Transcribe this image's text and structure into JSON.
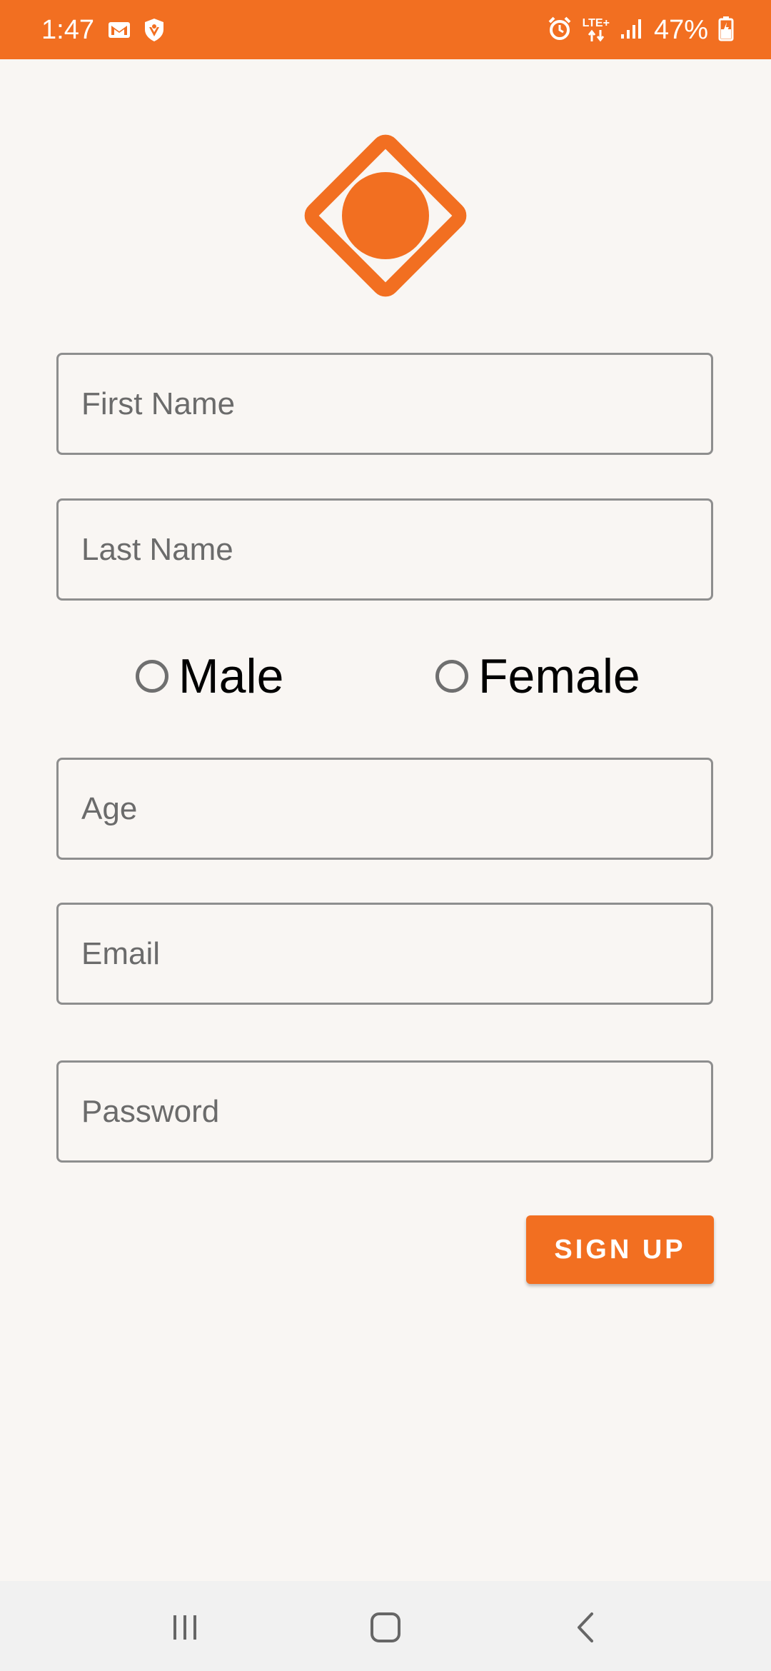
{
  "status_bar": {
    "time": "1:47",
    "battery": "47%",
    "network": "LTE+",
    "background_color": "#f26f21",
    "icons": [
      "gmail-icon",
      "shield-icon",
      "alarm-icon",
      "lte-icon",
      "signal-icon",
      "battery-icon"
    ]
  },
  "app": {
    "logo_icon": "diamond-circle-logo",
    "accent_color": "#f26f21"
  },
  "form": {
    "first_name": {
      "placeholder": "First Name",
      "value": ""
    },
    "last_name": {
      "placeholder": "Last Name",
      "value": ""
    },
    "gender": {
      "options": [
        "Male",
        "Female"
      ],
      "selected": null
    },
    "age": {
      "placeholder": "Age",
      "value": ""
    },
    "email": {
      "placeholder": "Email",
      "value": ""
    },
    "password": {
      "placeholder": "Password",
      "value": ""
    },
    "submit_label": "SIGN UP"
  },
  "nav_bar": {
    "icons": [
      "recent-apps-icon",
      "home-icon",
      "back-icon"
    ]
  }
}
